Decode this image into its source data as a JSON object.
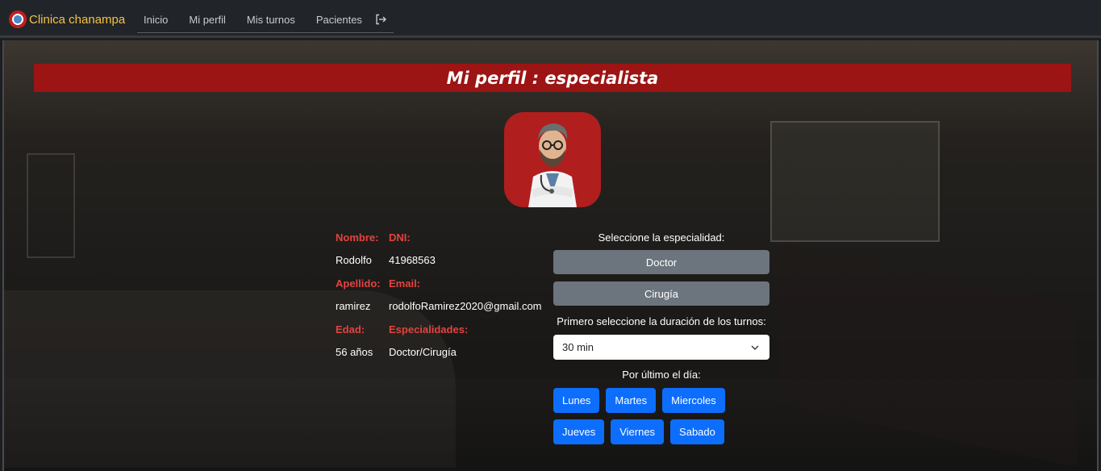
{
  "navbar": {
    "brand": "Clinica chanampa",
    "links": [
      "Inicio",
      "Mi perfil",
      "Mis turnos",
      "Pacientes"
    ],
    "logout_icon": "logout-icon"
  },
  "page": {
    "title": "Mi perfil : especialista"
  },
  "profile": {
    "nombre_label": "Nombre:",
    "nombre": "Rodolfo",
    "dni_label": "DNI:",
    "dni": "41968563",
    "apellido_label": "Apellido:",
    "apellido": "ramirez",
    "email_label": "Email:",
    "email": "rodolfoRamirez2020@gmail.com",
    "edad_label": "Edad:",
    "edad": "56 años",
    "especialidades_label": "Especialidades:",
    "especialidades": "Doctor/Cirugía"
  },
  "schedule": {
    "especialidad_label": "Seleccione la especialidad:",
    "especialidades": [
      "Doctor",
      "Cirugía"
    ],
    "duracion_label": "Primero seleccione la duración de los turnos:",
    "duracion_value": "30 min",
    "dia_label": "Por último el día:",
    "dias": [
      "Lunes",
      "Martes",
      "Miercoles",
      "Jueves",
      "Viernes",
      "Sabado"
    ]
  },
  "colors": {
    "brand": "#f5c242",
    "title_bar": "#9c1414",
    "label_red": "#e2433f",
    "primary": "#0d6efd",
    "secondary": "#6c757d"
  }
}
